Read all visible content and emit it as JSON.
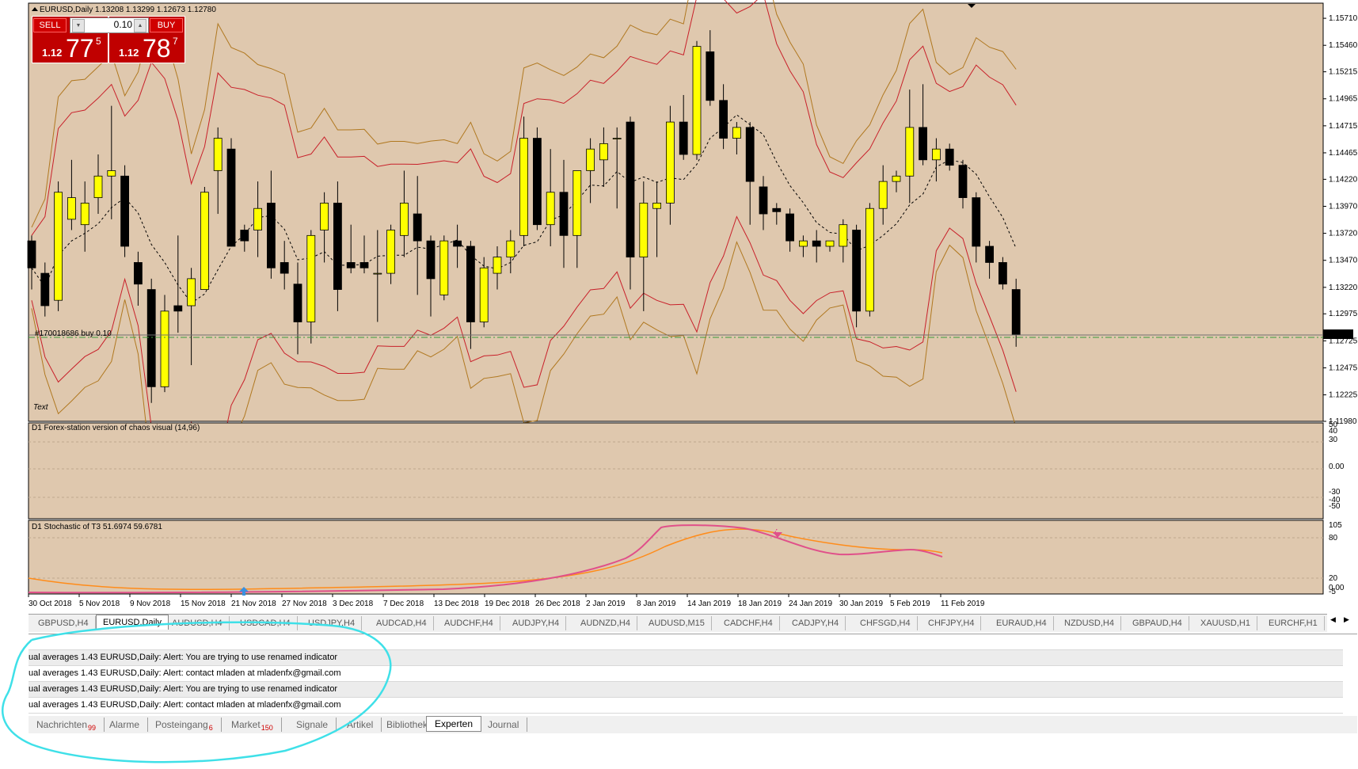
{
  "chart": {
    "title": "EURUSD,Daily  1.13208 1.13299 1.12673 1.12780",
    "y_ticks": [
      "1.15710",
      "1.15460",
      "1.15215",
      "1.14965",
      "1.14715",
      "1.14465",
      "1.14220",
      "1.13970",
      "1.13720",
      "1.13470",
      "1.13220",
      "1.12975",
      "1.12725",
      "1.12475",
      "1.12225",
      "1.11980"
    ],
    "y_range": [
      1.1198,
      1.1585
    ],
    "current_price": "1.12780",
    "order_label": "#170018686 buy 0.10",
    "text_object": "Text",
    "x_labels": [
      "30 Oct 2018",
      "5 Nov 2018",
      "9 Nov 2018",
      "15 Nov 2018",
      "21 Nov 2018",
      "27 Nov 2018",
      "3 Dec 2018",
      "7 Dec 2018",
      "13 Dec 2018",
      "19 Dec 2018",
      "26 Dec 2018",
      "2 Jan 2019",
      "8 Jan 2019",
      "14 Jan 2019",
      "18 Jan 2019",
      "24 Jan 2019",
      "30 Jan 2019",
      "5 Feb 2019",
      "11 Feb 2019"
    ],
    "candles": [
      [
        1.1365,
        1.137,
        1.132,
        1.134
      ],
      [
        1.1335,
        1.1345,
        1.1295,
        1.1305
      ],
      [
        1.131,
        1.142,
        1.13,
        1.141
      ],
      [
        1.1385,
        1.144,
        1.1375,
        1.1405
      ],
      [
        1.138,
        1.142,
        1.1355,
        1.14
      ],
      [
        1.1405,
        1.1445,
        1.139,
        1.1425
      ],
      [
        1.1425,
        1.149,
        1.1385,
        1.143
      ],
      [
        1.1425,
        1.1435,
        1.135,
        1.136
      ],
      [
        1.1345,
        1.1355,
        1.1305,
        1.1325
      ],
      [
        1.132,
        1.133,
        1.1215,
        1.123
      ],
      [
        1.123,
        1.1315,
        1.1225,
        1.13
      ],
      [
        1.1305,
        1.137,
        1.128,
        1.13
      ],
      [
        1.1305,
        1.134,
        1.125,
        1.133
      ],
      [
        1.132,
        1.1415,
        1.132,
        1.141
      ],
      [
        1.143,
        1.147,
        1.139,
        1.146
      ],
      [
        1.145,
        1.146,
        1.137,
        1.136
      ],
      [
        1.1375,
        1.138,
        1.1355,
        1.1365
      ],
      [
        1.1375,
        1.142,
        1.135,
        1.1395
      ],
      [
        1.14,
        1.143,
        1.133,
        1.134
      ],
      [
        1.1345,
        1.1365,
        1.132,
        1.1335
      ],
      [
        1.1325,
        1.1345,
        1.126,
        1.129
      ],
      [
        1.129,
        1.1375,
        1.127,
        1.137
      ],
      [
        1.1375,
        1.141,
        1.1345,
        1.14
      ],
      [
        1.14,
        1.142,
        1.13,
        1.132
      ],
      [
        1.1345,
        1.138,
        1.1335,
        1.134
      ],
      [
        1.1345,
        1.137,
        1.1335,
        1.134
      ],
      [
        1.1335,
        1.1375,
        1.129,
        1.1335
      ],
      [
        1.1335,
        1.138,
        1.1325,
        1.1375
      ],
      [
        1.137,
        1.143,
        1.135,
        1.14
      ],
      [
        1.139,
        1.1425,
        1.1315,
        1.1365
      ],
      [
        1.1365,
        1.137,
        1.1295,
        1.133
      ],
      [
        1.1315,
        1.137,
        1.131,
        1.1365
      ],
      [
        1.1365,
        1.138,
        1.134,
        1.136
      ],
      [
        1.136,
        1.1365,
        1.1265,
        1.129
      ],
      [
        1.129,
        1.135,
        1.1285,
        1.134
      ],
      [
        1.1335,
        1.136,
        1.132,
        1.135
      ],
      [
        1.135,
        1.1375,
        1.1335,
        1.1365
      ],
      [
        1.137,
        1.148,
        1.136,
        1.146
      ],
      [
        1.146,
        1.147,
        1.1375,
        1.138
      ],
      [
        1.138,
        1.145,
        1.136,
        1.141
      ],
      [
        1.141,
        1.144,
        1.134,
        1.137
      ],
      [
        1.137,
        1.143,
        1.134,
        1.143
      ],
      [
        1.143,
        1.146,
        1.14,
        1.145
      ],
      [
        1.144,
        1.147,
        1.1415,
        1.1455
      ],
      [
        1.146,
        1.147,
        1.1395,
        1.146
      ],
      [
        1.1475,
        1.148,
        1.132,
        1.135
      ],
      [
        1.135,
        1.142,
        1.13,
        1.14
      ],
      [
        1.1395,
        1.142,
        1.135,
        1.14
      ],
      [
        1.14,
        1.149,
        1.138,
        1.1475
      ],
      [
        1.1475,
        1.15,
        1.144,
        1.1445
      ],
      [
        1.1445,
        1.155,
        1.144,
        1.1545
      ],
      [
        1.154,
        1.156,
        1.149,
        1.1495
      ],
      [
        1.1495,
        1.151,
        1.145,
        1.146
      ],
      [
        1.146,
        1.1475,
        1.1445,
        1.147
      ],
      [
        1.147,
        1.1475,
        1.138,
        1.142
      ],
      [
        1.1415,
        1.1425,
        1.1375,
        1.139
      ],
      [
        1.1395,
        1.14,
        1.138,
        1.1392
      ],
      [
        1.139,
        1.1395,
        1.1355,
        1.1365
      ],
      [
        1.136,
        1.137,
        1.135,
        1.1365
      ],
      [
        1.1365,
        1.1375,
        1.1345,
        1.136
      ],
      [
        1.136,
        1.1365,
        1.1355,
        1.1365
      ],
      [
        1.136,
        1.1385,
        1.1345,
        1.138
      ],
      [
        1.1375,
        1.138,
        1.1285,
        1.13
      ],
      [
        1.13,
        1.14,
        1.1295,
        1.1395
      ],
      [
        1.1395,
        1.1435,
        1.138,
        1.142
      ],
      [
        1.142,
        1.143,
        1.141,
        1.1425
      ],
      [
        1.1425,
        1.1505,
        1.14,
        1.147
      ],
      [
        1.147,
        1.151,
        1.1435,
        1.144
      ],
      [
        1.144,
        1.146,
        1.142,
        1.145
      ],
      [
        1.145,
        1.1455,
        1.143,
        1.1435
      ],
      [
        1.1435,
        1.144,
        1.1395,
        1.1405
      ],
      [
        1.1405,
        1.141,
        1.1345,
        1.136
      ],
      [
        1.136,
        1.1365,
        1.133,
        1.1345
      ],
      [
        1.1345,
        1.135,
        1.132,
        1.1325
      ],
      [
        1.132,
        1.133,
        1.1267,
        1.1278
      ]
    ],
    "sell_label": "SELL",
    "buy_label": "BUY",
    "lot_value": "0.10",
    "sell_price": {
      "prefix": "1.12",
      "big": "77",
      "sup": "5"
    },
    "buy_price": {
      "prefix": "1.12",
      "big": "78",
      "sup": "7"
    }
  },
  "indicator1": {
    "label": "D1 Forex-station version of chaos visual (14,96)",
    "ticks": [
      "50",
      "40",
      "30",
      "0.00",
      "-30",
      "-40",
      "-50"
    ]
  },
  "indicator2": {
    "label": "D1   Stochastic of T3 51.6974 59.6781",
    "ticks": [
      "105",
      "80",
      "20",
      "-5",
      "0.00"
    ]
  },
  "symbol_tabs": [
    "GBPUSD,H4",
    "EURUSD,Daily",
    "AUDUSD,H4",
    "USDCAD,H4",
    "USDJPY,H4",
    "AUDCAD,H4",
    "AUDCHF,H4",
    "AUDJPY,H4",
    "AUDNZD,H4",
    "AUDUSD,M15",
    "CADCHF,H4",
    "CADJPY,H4",
    "CHFSGD,H4",
    "CHFJPY,H4",
    "EURAUD,H4",
    "NZDUSD,H4",
    "GBPAUD,H4",
    "XAUUSD,H1",
    "EURCHF,H1"
  ],
  "terminal_rows": [
    "ual averages 1.43 EURUSD,Daily: Alert: You are trying to use renamed indicator",
    "ual averages 1.43 EURUSD,Daily: Alert: contact mladen at mladenfx@gmail.com",
    "ual averages 1.43 EURUSD,Daily: Alert: You are trying to use renamed indicator",
    "ual averages 1.43 EURUSD,Daily: Alert: contact mladen at mladenfx@gmail.com"
  ],
  "bottom_tabs": [
    {
      "label": "Nachrichten",
      "count": "99"
    },
    {
      "label": "Alarme",
      "count": ""
    },
    {
      "label": "Posteingang",
      "count": "6"
    },
    {
      "label": "Market",
      "count": "150"
    },
    {
      "label": "Signale",
      "count": ""
    },
    {
      "label": "Artikel",
      "count": ""
    },
    {
      "label": "Bibliothek",
      "count": ""
    },
    {
      "label": "Experten",
      "count": ""
    },
    {
      "label": "Journal",
      "count": ""
    }
  ],
  "colors": {
    "chart_bg": "#dfc8ae",
    "bull": "#ffff00",
    "bear": "#000000",
    "annotation": "#3fe0e8",
    "stoch_main": "#e0508a",
    "stoch_signal": "#ff8c1a"
  }
}
